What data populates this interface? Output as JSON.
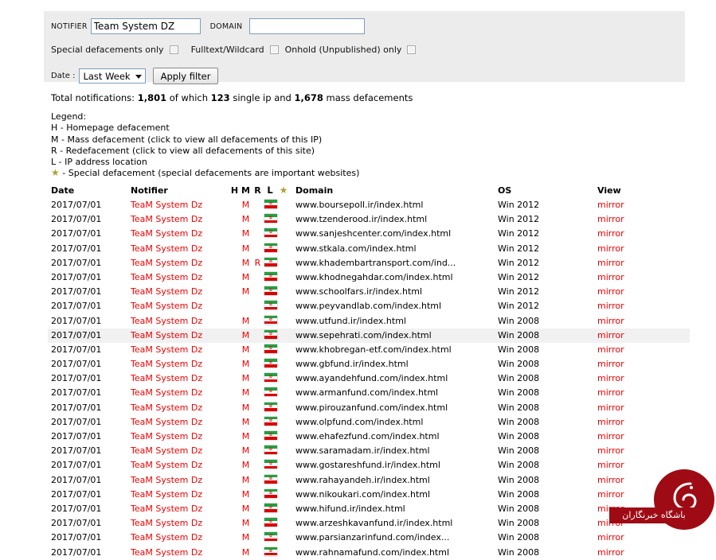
{
  "filter": {
    "notifier_label": "NOTIFIER",
    "notifier_value": "Team System DZ",
    "notifier_placeholder": "",
    "domain_label": "DOMAIN",
    "domain_value": "",
    "domain_placeholder": "",
    "special_only_label": "Special defacements only",
    "fulltext_label": "Fulltext/Wildcard",
    "onhold_label": "Onhold (Unpublished) only",
    "date_label": "Date :",
    "date_value": "Last Week",
    "date_options": [
      "Last Week"
    ],
    "apply_label": "Apply filter"
  },
  "totals": {
    "prefix": "Total notifications:",
    "total": "1,801",
    "mid1": "of which",
    "single_ip": "123",
    "mid2": "single ip and",
    "mass": "1,678",
    "suffix": "mass defacements"
  },
  "legend": {
    "title": "Legend:",
    "lines": [
      "H - Homepage defacement",
      "M - Mass defacement (click to view all defacements of this IP)",
      "R - Redefacement (click to view all defacements of this site)",
      "L - IP address location"
    ],
    "star_glyph": "★",
    "star_line": "- Special defacement (special defacements are important websites)"
  },
  "table": {
    "headers": {
      "date": "Date",
      "notifier": "Notifier",
      "h": "H",
      "m": "M",
      "r": "R",
      "l": "L",
      "star": "★",
      "domain": "Domain",
      "os": "OS",
      "view": "View"
    },
    "rows": [
      {
        "date": "2017/07/01",
        "notifier": "TeaM System Dz",
        "h": "",
        "m": "M",
        "r": "",
        "l": "iran-flag",
        "star": "",
        "domain": "www.boursepoll.ir/index.html",
        "os": "Win 2012",
        "view": "mirror",
        "highlight": false
      },
      {
        "date": "2017/07/01",
        "notifier": "TeaM System Dz",
        "h": "",
        "m": "M",
        "r": "",
        "l": "iran-flag",
        "star": "",
        "domain": "www.tzenderood.ir/index.html",
        "os": "Win 2012",
        "view": "mirror",
        "highlight": false
      },
      {
        "date": "2017/07/01",
        "notifier": "TeaM System Dz",
        "h": "",
        "m": "M",
        "r": "",
        "l": "iran-flag",
        "star": "",
        "domain": "www.sanjeshcenter.com/index.html",
        "os": "Win 2012",
        "view": "mirror",
        "highlight": false
      },
      {
        "date": "2017/07/01",
        "notifier": "TeaM System Dz",
        "h": "",
        "m": "M",
        "r": "",
        "l": "iran-flag",
        "star": "",
        "domain": "www.stkala.com/index.html",
        "os": "Win 2012",
        "view": "mirror",
        "highlight": false
      },
      {
        "date": "2017/07/01",
        "notifier": "TeaM System Dz",
        "h": "",
        "m": "M",
        "r": "R",
        "l": "iran-flag",
        "star": "",
        "domain": "www.khadembartransport.com/ind...",
        "os": "Win 2012",
        "view": "mirror",
        "highlight": false
      },
      {
        "date": "2017/07/01",
        "notifier": "TeaM System Dz",
        "h": "",
        "m": "M",
        "r": "",
        "l": "iran-flag",
        "star": "",
        "domain": "www.khodnegahdar.com/index.html",
        "os": "Win 2012",
        "view": "mirror",
        "highlight": false
      },
      {
        "date": "2017/07/01",
        "notifier": "TeaM System Dz",
        "h": "",
        "m": "M",
        "r": "",
        "l": "iran-flag",
        "star": "",
        "domain": "www.schoolfars.ir/index.html",
        "os": "Win 2012",
        "view": "mirror",
        "highlight": false
      },
      {
        "date": "2017/07/01",
        "notifier": "TeaM System Dz",
        "h": "",
        "m": "",
        "r": "",
        "l": "iran-flag",
        "star": "",
        "domain": "www.peyvandlab.com/index.html",
        "os": "Win 2012",
        "view": "mirror",
        "highlight": false
      },
      {
        "date": "2017/07/01",
        "notifier": "TeaM System Dz",
        "h": "",
        "m": "M",
        "r": "",
        "l": "iran-flag",
        "star": "",
        "domain": "www.utfund.ir/index.html",
        "os": "Win 2008",
        "view": "mirror",
        "highlight": false
      },
      {
        "date": "2017/07/01",
        "notifier": "TeaM System Dz",
        "h": "",
        "m": "M",
        "r": "",
        "l": "iran-flag",
        "star": "",
        "domain": "www.sepehrati.com/index.html",
        "os": "Win 2008",
        "view": "mirror",
        "highlight": true
      },
      {
        "date": "2017/07/01",
        "notifier": "TeaM System Dz",
        "h": "",
        "m": "M",
        "r": "",
        "l": "iran-flag",
        "star": "",
        "domain": "www.khobregan-etf.com/index.html",
        "os": "Win 2008",
        "view": "mirror",
        "highlight": false
      },
      {
        "date": "2017/07/01",
        "notifier": "TeaM System Dz",
        "h": "",
        "m": "M",
        "r": "",
        "l": "iran-flag",
        "star": "",
        "domain": "www.gbfund.ir/index.html",
        "os": "Win 2008",
        "view": "mirror",
        "highlight": false
      },
      {
        "date": "2017/07/01",
        "notifier": "TeaM System Dz",
        "h": "",
        "m": "M",
        "r": "",
        "l": "iran-flag",
        "star": "",
        "domain": "www.ayandehfund.com/index.html",
        "os": "Win 2008",
        "view": "mirror",
        "highlight": false
      },
      {
        "date": "2017/07/01",
        "notifier": "TeaM System Dz",
        "h": "",
        "m": "M",
        "r": "",
        "l": "iran-flag",
        "star": "",
        "domain": "www.armanfund.com/index.html",
        "os": "Win 2008",
        "view": "mirror",
        "highlight": false
      },
      {
        "date": "2017/07/01",
        "notifier": "TeaM System Dz",
        "h": "",
        "m": "M",
        "r": "",
        "l": "iran-flag",
        "star": "",
        "domain": "www.pirouzanfund.com/index.html",
        "os": "Win 2008",
        "view": "mirror",
        "highlight": false
      },
      {
        "date": "2017/07/01",
        "notifier": "TeaM System Dz",
        "h": "",
        "m": "M",
        "r": "",
        "l": "iran-flag",
        "star": "",
        "domain": "www.olpfund.com/index.html",
        "os": "Win 2008",
        "view": "mirror",
        "highlight": false
      },
      {
        "date": "2017/07/01",
        "notifier": "TeaM System Dz",
        "h": "",
        "m": "M",
        "r": "",
        "l": "iran-flag",
        "star": "",
        "domain": "www.ehafezfund.com/index.html",
        "os": "Win 2008",
        "view": "mirror",
        "highlight": false
      },
      {
        "date": "2017/07/01",
        "notifier": "TeaM System Dz",
        "h": "",
        "m": "M",
        "r": "",
        "l": "iran-flag",
        "star": "",
        "domain": "www.saramadam.ir/index.html",
        "os": "Win 2008",
        "view": "mirror",
        "highlight": false
      },
      {
        "date": "2017/07/01",
        "notifier": "TeaM System Dz",
        "h": "",
        "m": "M",
        "r": "",
        "l": "iran-flag",
        "star": "",
        "domain": "www.gostareshfund.ir/index.html",
        "os": "Win 2008",
        "view": "mirror",
        "highlight": false
      },
      {
        "date": "2017/07/01",
        "notifier": "TeaM System Dz",
        "h": "",
        "m": "M",
        "r": "",
        "l": "iran-flag",
        "star": "",
        "domain": "www.rahayandeh.ir/index.html",
        "os": "Win 2008",
        "view": "mirror",
        "highlight": false
      },
      {
        "date": "2017/07/01",
        "notifier": "TeaM System Dz",
        "h": "",
        "m": "M",
        "r": "",
        "l": "iran-flag",
        "star": "",
        "domain": "www.nikoukari.com/index.html",
        "os": "Win 2008",
        "view": "mirror",
        "highlight": false
      },
      {
        "date": "2017/07/01",
        "notifier": "TeaM System Dz",
        "h": "",
        "m": "M",
        "r": "",
        "l": "iran-flag",
        "star": "",
        "domain": "www.hifund.ir/index.html",
        "os": "Win 2008",
        "view": "mirror",
        "highlight": false
      },
      {
        "date": "2017/07/01",
        "notifier": "TeaM System Dz",
        "h": "",
        "m": "M",
        "r": "",
        "l": "iran-flag",
        "star": "",
        "domain": "www.arzeshkavanfund.ir/index.html",
        "os": "Win 2008",
        "view": "mirror",
        "highlight": false
      },
      {
        "date": "2017/07/01",
        "notifier": "TeaM System Dz",
        "h": "",
        "m": "M",
        "r": "",
        "l": "iran-flag",
        "star": "",
        "domain": "www.parsianzarinfund.com/index...",
        "os": "Win 2008",
        "view": "mirror",
        "highlight": false
      },
      {
        "date": "2017/07/01",
        "notifier": "TeaM System Dz",
        "h": "",
        "m": "M",
        "r": "",
        "l": "iran-flag",
        "star": "",
        "domain": "www.rahnamafund.com/index.html",
        "os": "Win 2008",
        "view": "mirror",
        "highlight": false
      }
    ]
  },
  "watermark": {
    "text": "باشگاه خبرنگاران",
    "color": "#9e0b14"
  },
  "colors": {
    "link_red": "#f00000",
    "panel_bg": "#ececec",
    "row_highlight": "#f1f1f1",
    "star_gold": "#b3a033"
  }
}
